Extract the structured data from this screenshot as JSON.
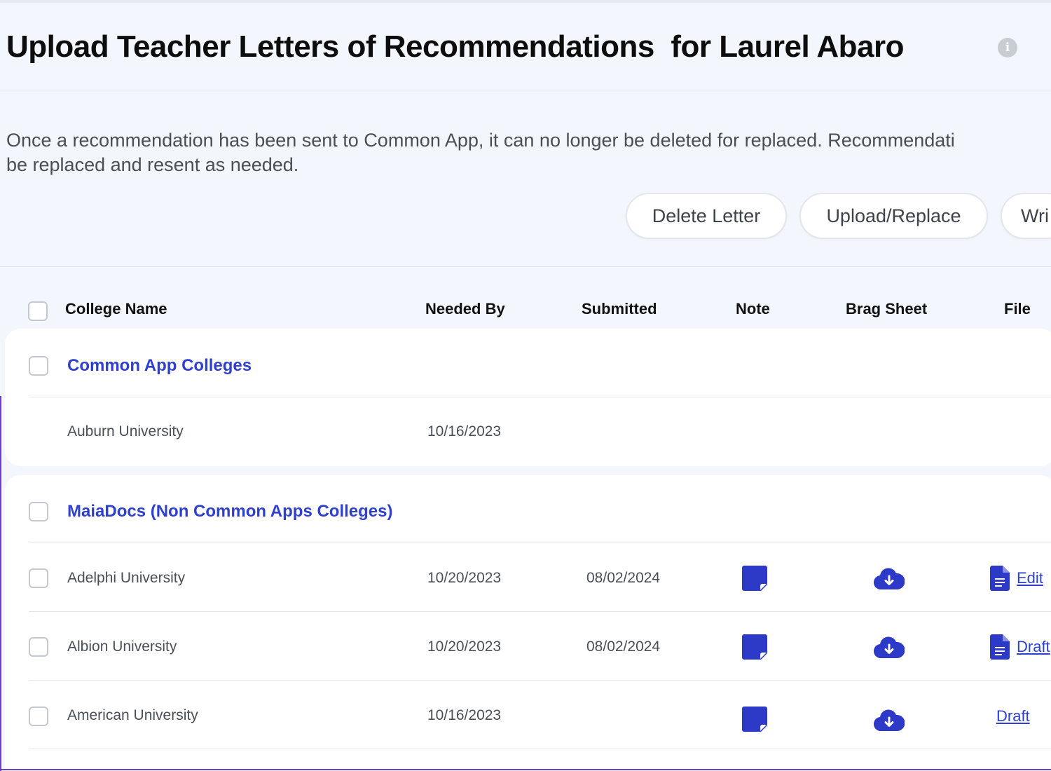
{
  "page": {
    "title": "Upload Teacher Letters of Recommendations  for Laurel Abaro",
    "info_icon": "info-icon",
    "notice_line1": "Once a recommendation has been sent to Common App, it can no longer be deleted for replaced. Recommendati",
    "notice_line2": "be replaced and resent as needed."
  },
  "toolbar": {
    "delete_label": "Delete Letter",
    "upload_label": "Upload/Replace",
    "write_label": "Wri"
  },
  "table": {
    "columns": {
      "college": "College Name",
      "needed_by": "Needed By",
      "submitted": "Submitted",
      "note": "Note",
      "brag": "Brag Sheet",
      "file": "File"
    },
    "groups": [
      {
        "title": "Common App Colleges",
        "rows": [
          {
            "name": "Auburn University",
            "needed_by": "10/16/2023",
            "submitted": ""
          }
        ]
      },
      {
        "title": "MaiaDocs (Non Common Apps Colleges)",
        "rows": [
          {
            "name": "Adelphi University",
            "needed_by": "10/20/2023",
            "submitted": "08/02/2024",
            "file_link": "Edit"
          },
          {
            "name": "Albion University",
            "needed_by": "10/20/2023",
            "submitted": "08/02/2024",
            "file_link": "Draft"
          },
          {
            "name": "American University",
            "needed_by": "10/16/2023",
            "submitted": "",
            "file_link": "Draft"
          }
        ]
      }
    ]
  },
  "colors": {
    "accent": "#2f3fcf",
    "icon_blue": "#2d39c7",
    "background": "#f3f6fd"
  }
}
